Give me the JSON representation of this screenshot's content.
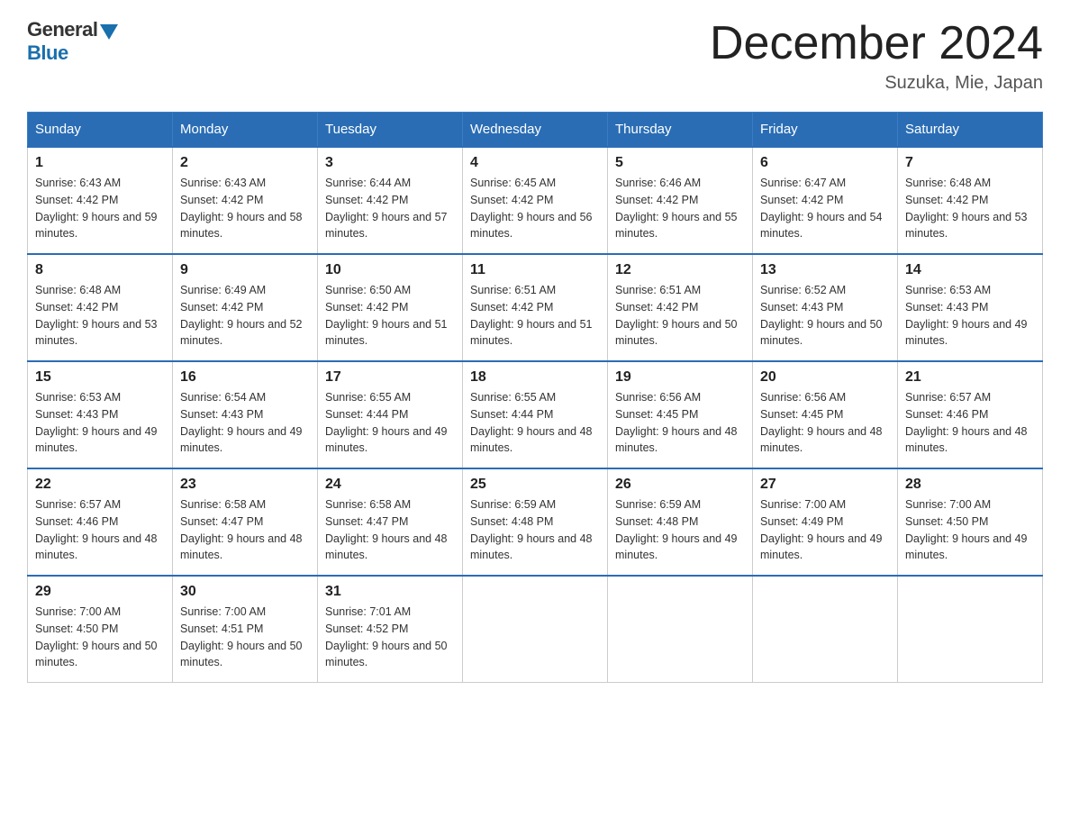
{
  "header": {
    "logo": {
      "general": "General",
      "blue": "Blue"
    },
    "title": "December 2024",
    "location": "Suzuka, Mie, Japan"
  },
  "days_of_week": [
    "Sunday",
    "Monday",
    "Tuesday",
    "Wednesday",
    "Thursday",
    "Friday",
    "Saturday"
  ],
  "weeks": [
    [
      {
        "day": "1",
        "sunrise": "6:43 AM",
        "sunset": "4:42 PM",
        "daylight": "9 hours and 59 minutes."
      },
      {
        "day": "2",
        "sunrise": "6:43 AM",
        "sunset": "4:42 PM",
        "daylight": "9 hours and 58 minutes."
      },
      {
        "day": "3",
        "sunrise": "6:44 AM",
        "sunset": "4:42 PM",
        "daylight": "9 hours and 57 minutes."
      },
      {
        "day": "4",
        "sunrise": "6:45 AM",
        "sunset": "4:42 PM",
        "daylight": "9 hours and 56 minutes."
      },
      {
        "day": "5",
        "sunrise": "6:46 AM",
        "sunset": "4:42 PM",
        "daylight": "9 hours and 55 minutes."
      },
      {
        "day": "6",
        "sunrise": "6:47 AM",
        "sunset": "4:42 PM",
        "daylight": "9 hours and 54 minutes."
      },
      {
        "day": "7",
        "sunrise": "6:48 AM",
        "sunset": "4:42 PM",
        "daylight": "9 hours and 53 minutes."
      }
    ],
    [
      {
        "day": "8",
        "sunrise": "6:48 AM",
        "sunset": "4:42 PM",
        "daylight": "9 hours and 53 minutes."
      },
      {
        "day": "9",
        "sunrise": "6:49 AM",
        "sunset": "4:42 PM",
        "daylight": "9 hours and 52 minutes."
      },
      {
        "day": "10",
        "sunrise": "6:50 AM",
        "sunset": "4:42 PM",
        "daylight": "9 hours and 51 minutes."
      },
      {
        "day": "11",
        "sunrise": "6:51 AM",
        "sunset": "4:42 PM",
        "daylight": "9 hours and 51 minutes."
      },
      {
        "day": "12",
        "sunrise": "6:51 AM",
        "sunset": "4:42 PM",
        "daylight": "9 hours and 50 minutes."
      },
      {
        "day": "13",
        "sunrise": "6:52 AM",
        "sunset": "4:43 PM",
        "daylight": "9 hours and 50 minutes."
      },
      {
        "day": "14",
        "sunrise": "6:53 AM",
        "sunset": "4:43 PM",
        "daylight": "9 hours and 49 minutes."
      }
    ],
    [
      {
        "day": "15",
        "sunrise": "6:53 AM",
        "sunset": "4:43 PM",
        "daylight": "9 hours and 49 minutes."
      },
      {
        "day": "16",
        "sunrise": "6:54 AM",
        "sunset": "4:43 PM",
        "daylight": "9 hours and 49 minutes."
      },
      {
        "day": "17",
        "sunrise": "6:55 AM",
        "sunset": "4:44 PM",
        "daylight": "9 hours and 49 minutes."
      },
      {
        "day": "18",
        "sunrise": "6:55 AM",
        "sunset": "4:44 PM",
        "daylight": "9 hours and 48 minutes."
      },
      {
        "day": "19",
        "sunrise": "6:56 AM",
        "sunset": "4:45 PM",
        "daylight": "9 hours and 48 minutes."
      },
      {
        "day": "20",
        "sunrise": "6:56 AM",
        "sunset": "4:45 PM",
        "daylight": "9 hours and 48 minutes."
      },
      {
        "day": "21",
        "sunrise": "6:57 AM",
        "sunset": "4:46 PM",
        "daylight": "9 hours and 48 minutes."
      }
    ],
    [
      {
        "day": "22",
        "sunrise": "6:57 AM",
        "sunset": "4:46 PM",
        "daylight": "9 hours and 48 minutes."
      },
      {
        "day": "23",
        "sunrise": "6:58 AM",
        "sunset": "4:47 PM",
        "daylight": "9 hours and 48 minutes."
      },
      {
        "day": "24",
        "sunrise": "6:58 AM",
        "sunset": "4:47 PM",
        "daylight": "9 hours and 48 minutes."
      },
      {
        "day": "25",
        "sunrise": "6:59 AM",
        "sunset": "4:48 PM",
        "daylight": "9 hours and 48 minutes."
      },
      {
        "day": "26",
        "sunrise": "6:59 AM",
        "sunset": "4:48 PM",
        "daylight": "9 hours and 49 minutes."
      },
      {
        "day": "27",
        "sunrise": "7:00 AM",
        "sunset": "4:49 PM",
        "daylight": "9 hours and 49 minutes."
      },
      {
        "day": "28",
        "sunrise": "7:00 AM",
        "sunset": "4:50 PM",
        "daylight": "9 hours and 49 minutes."
      }
    ],
    [
      {
        "day": "29",
        "sunrise": "7:00 AM",
        "sunset": "4:50 PM",
        "daylight": "9 hours and 50 minutes."
      },
      {
        "day": "30",
        "sunrise": "7:00 AM",
        "sunset": "4:51 PM",
        "daylight": "9 hours and 50 minutes."
      },
      {
        "day": "31",
        "sunrise": "7:01 AM",
        "sunset": "4:52 PM",
        "daylight": "9 hours and 50 minutes."
      },
      null,
      null,
      null,
      null
    ]
  ]
}
